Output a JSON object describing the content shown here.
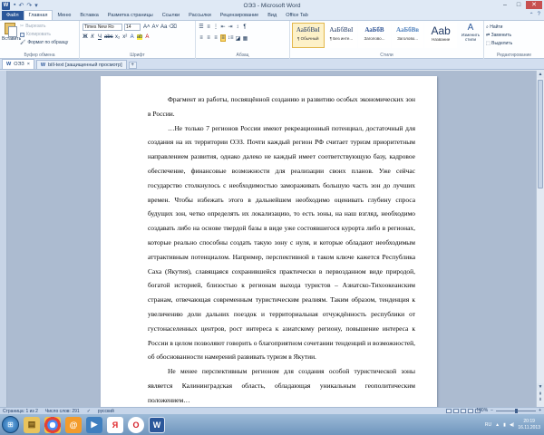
{
  "window": {
    "title": "ОЭЗ - Microsoft Word",
    "controls": {
      "minimize": "–",
      "maximize": "□",
      "close": "✕"
    }
  },
  "ribbon_tabs": [
    {
      "label": "Файл"
    },
    {
      "label": "Главная",
      "active": true
    },
    {
      "label": "Меню"
    },
    {
      "label": "Вставка"
    },
    {
      "label": "Разметка страницы"
    },
    {
      "label": "Ссылки"
    },
    {
      "label": "Рассылки"
    },
    {
      "label": "Рецензирование"
    },
    {
      "label": "Вид"
    },
    {
      "label": "Office Tab"
    }
  ],
  "clipboard": {
    "paste": "Вставить",
    "cut": "Вырезать",
    "copy": "Копировать",
    "format_painter": "Формат по образцу",
    "group_label": "Буфер обмена"
  },
  "font": {
    "name": "Times New Ro",
    "size": "14",
    "group_label": "Шрифт"
  },
  "paragraph": {
    "group_label": "Абзац"
  },
  "styles": {
    "items": [
      {
        "sample": "АаБбВвІ",
        "name": "¶ Обычный",
        "selected": true
      },
      {
        "sample": "АаБбВвІ",
        "name": "¶ Без инте..."
      },
      {
        "sample": "АаБбВ",
        "name": "Заголово..."
      },
      {
        "sample": "АаБбВв",
        "name": "Заголово..."
      },
      {
        "sample": "Aab",
        "name": "Название"
      }
    ],
    "change_styles": "Изменить стили",
    "group_label": "Стили"
  },
  "editing": {
    "find": "Найти",
    "replace": "Заменить",
    "select": "Выделить",
    "group_label": "Редактирование"
  },
  "doc_tabs": [
    {
      "label": "ОЭЗ",
      "active": true
    },
    {
      "label": "bill-text [защищенный просмотр]"
    }
  ],
  "document": {
    "paragraphs": [
      "Фрагмент из работы, посвящённой созданию и развитию особых экономических зон в России.",
      "…Не только 7 регионов России имеют рекреационный потенциал, достаточный для создания на их территории ОЭЗ. Почти каждый регион РФ считает туризм приоритетным направлением развития, однако далеко не каждый имеет соответствующую базу, кадровое обеспечение, финансовые возможности для реализации своих планов. Уже сейчас государство столкнулось с необходимостью замораживать большую часть зон до лучших времен. Чтобы избежать этого в дальнейшем необходимо оценивать глубину спроса будущих зон, четко определять их локализацию, то есть зоны, на наш взгляд, необходимо создавать либо на основе твердой базы в виде уже состоявшегося курорта либо в регионах, которые реально способны создать такую зону с нуля, и которые обладают необходимым аттрактивным потенциалом. Например, перспективной в таком ключе кажется Республика Саха (Якутия), славящаяся сохранившейся практически в первозданном виде природой, богатой историей, близостью к регионам выхода туристов – Азиатско-Тихоокеанским странам, отвечающая современным туристическим реалиям. Таким образом, тенденция к увеличению доли дальних поездок и территориальная отчуждённость республики от густонаселенных центров, рост интереса к азиатскому региону, повышение интереса к России в целом позволяют говорить о благоприятном сочетании тенденций и возможностей, об обоснованности намерений развивать туризм в Якутии.",
      "Не менее перспективным регионом для создания особой туристической зоны является Калининградская область, обладающая уникальным геополитическим положением…"
    ]
  },
  "status": {
    "page": "Страница: 1 из 2",
    "words": "Число слов: 291",
    "language": "русский",
    "zoom": "100%",
    "zoom_level": 0.5
  },
  "taskbar": {
    "icons": [
      "windows-explorer",
      "chrome",
      "mail",
      "media",
      "yandex",
      "opera",
      "word"
    ],
    "tray_lang": "RU",
    "time": "20:19",
    "date": "16.11.2013"
  },
  "colors": {
    "word_blue": "#2b579a",
    "ribbon_bg": "#fdfeff",
    "workspace": "#acbbd0",
    "taskbar": "#6f95bd"
  }
}
